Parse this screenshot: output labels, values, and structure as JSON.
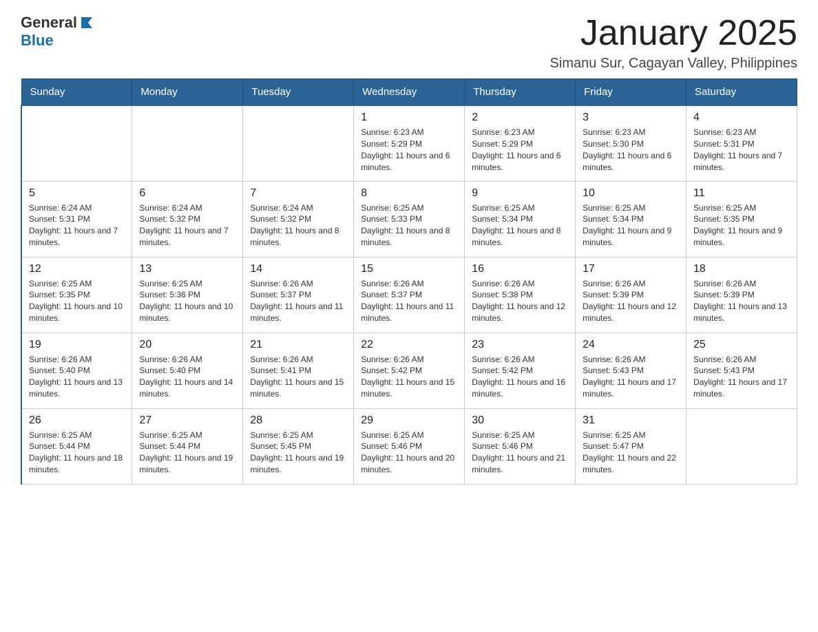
{
  "header": {
    "logo_general": "General",
    "logo_blue": "Blue",
    "title": "January 2025",
    "subtitle": "Simanu Sur, Cagayan Valley, Philippines"
  },
  "days_of_week": [
    "Sunday",
    "Monday",
    "Tuesday",
    "Wednesday",
    "Thursday",
    "Friday",
    "Saturday"
  ],
  "weeks": [
    [
      {
        "day": "",
        "info": ""
      },
      {
        "day": "",
        "info": ""
      },
      {
        "day": "",
        "info": ""
      },
      {
        "day": "1",
        "info": "Sunrise: 6:23 AM\nSunset: 5:29 PM\nDaylight: 11 hours and 6 minutes."
      },
      {
        "day": "2",
        "info": "Sunrise: 6:23 AM\nSunset: 5:29 PM\nDaylight: 11 hours and 6 minutes."
      },
      {
        "day": "3",
        "info": "Sunrise: 6:23 AM\nSunset: 5:30 PM\nDaylight: 11 hours and 6 minutes."
      },
      {
        "day": "4",
        "info": "Sunrise: 6:23 AM\nSunset: 5:31 PM\nDaylight: 11 hours and 7 minutes."
      }
    ],
    [
      {
        "day": "5",
        "info": "Sunrise: 6:24 AM\nSunset: 5:31 PM\nDaylight: 11 hours and 7 minutes."
      },
      {
        "day": "6",
        "info": "Sunrise: 6:24 AM\nSunset: 5:32 PM\nDaylight: 11 hours and 7 minutes."
      },
      {
        "day": "7",
        "info": "Sunrise: 6:24 AM\nSunset: 5:32 PM\nDaylight: 11 hours and 8 minutes."
      },
      {
        "day": "8",
        "info": "Sunrise: 6:25 AM\nSunset: 5:33 PM\nDaylight: 11 hours and 8 minutes."
      },
      {
        "day": "9",
        "info": "Sunrise: 6:25 AM\nSunset: 5:34 PM\nDaylight: 11 hours and 8 minutes."
      },
      {
        "day": "10",
        "info": "Sunrise: 6:25 AM\nSunset: 5:34 PM\nDaylight: 11 hours and 9 minutes."
      },
      {
        "day": "11",
        "info": "Sunrise: 6:25 AM\nSunset: 5:35 PM\nDaylight: 11 hours and 9 minutes."
      }
    ],
    [
      {
        "day": "12",
        "info": "Sunrise: 6:25 AM\nSunset: 5:35 PM\nDaylight: 11 hours and 10 minutes."
      },
      {
        "day": "13",
        "info": "Sunrise: 6:25 AM\nSunset: 5:36 PM\nDaylight: 11 hours and 10 minutes."
      },
      {
        "day": "14",
        "info": "Sunrise: 6:26 AM\nSunset: 5:37 PM\nDaylight: 11 hours and 11 minutes."
      },
      {
        "day": "15",
        "info": "Sunrise: 6:26 AM\nSunset: 5:37 PM\nDaylight: 11 hours and 11 minutes."
      },
      {
        "day": "16",
        "info": "Sunrise: 6:26 AM\nSunset: 5:38 PM\nDaylight: 11 hours and 12 minutes."
      },
      {
        "day": "17",
        "info": "Sunrise: 6:26 AM\nSunset: 5:39 PM\nDaylight: 11 hours and 12 minutes."
      },
      {
        "day": "18",
        "info": "Sunrise: 6:26 AM\nSunset: 5:39 PM\nDaylight: 11 hours and 13 minutes."
      }
    ],
    [
      {
        "day": "19",
        "info": "Sunrise: 6:26 AM\nSunset: 5:40 PM\nDaylight: 11 hours and 13 minutes."
      },
      {
        "day": "20",
        "info": "Sunrise: 6:26 AM\nSunset: 5:40 PM\nDaylight: 11 hours and 14 minutes."
      },
      {
        "day": "21",
        "info": "Sunrise: 6:26 AM\nSunset: 5:41 PM\nDaylight: 11 hours and 15 minutes."
      },
      {
        "day": "22",
        "info": "Sunrise: 6:26 AM\nSunset: 5:42 PM\nDaylight: 11 hours and 15 minutes."
      },
      {
        "day": "23",
        "info": "Sunrise: 6:26 AM\nSunset: 5:42 PM\nDaylight: 11 hours and 16 minutes."
      },
      {
        "day": "24",
        "info": "Sunrise: 6:26 AM\nSunset: 5:43 PM\nDaylight: 11 hours and 17 minutes."
      },
      {
        "day": "25",
        "info": "Sunrise: 6:26 AM\nSunset: 5:43 PM\nDaylight: 11 hours and 17 minutes."
      }
    ],
    [
      {
        "day": "26",
        "info": "Sunrise: 6:25 AM\nSunset: 5:44 PM\nDaylight: 11 hours and 18 minutes."
      },
      {
        "day": "27",
        "info": "Sunrise: 6:25 AM\nSunset: 5:44 PM\nDaylight: 11 hours and 19 minutes."
      },
      {
        "day": "28",
        "info": "Sunrise: 6:25 AM\nSunset: 5:45 PM\nDaylight: 11 hours and 19 minutes."
      },
      {
        "day": "29",
        "info": "Sunrise: 6:25 AM\nSunset: 5:46 PM\nDaylight: 11 hours and 20 minutes."
      },
      {
        "day": "30",
        "info": "Sunrise: 6:25 AM\nSunset: 5:46 PM\nDaylight: 11 hours and 21 minutes."
      },
      {
        "day": "31",
        "info": "Sunrise: 6:25 AM\nSunset: 5:47 PM\nDaylight: 11 hours and 22 minutes."
      },
      {
        "day": "",
        "info": ""
      }
    ]
  ]
}
